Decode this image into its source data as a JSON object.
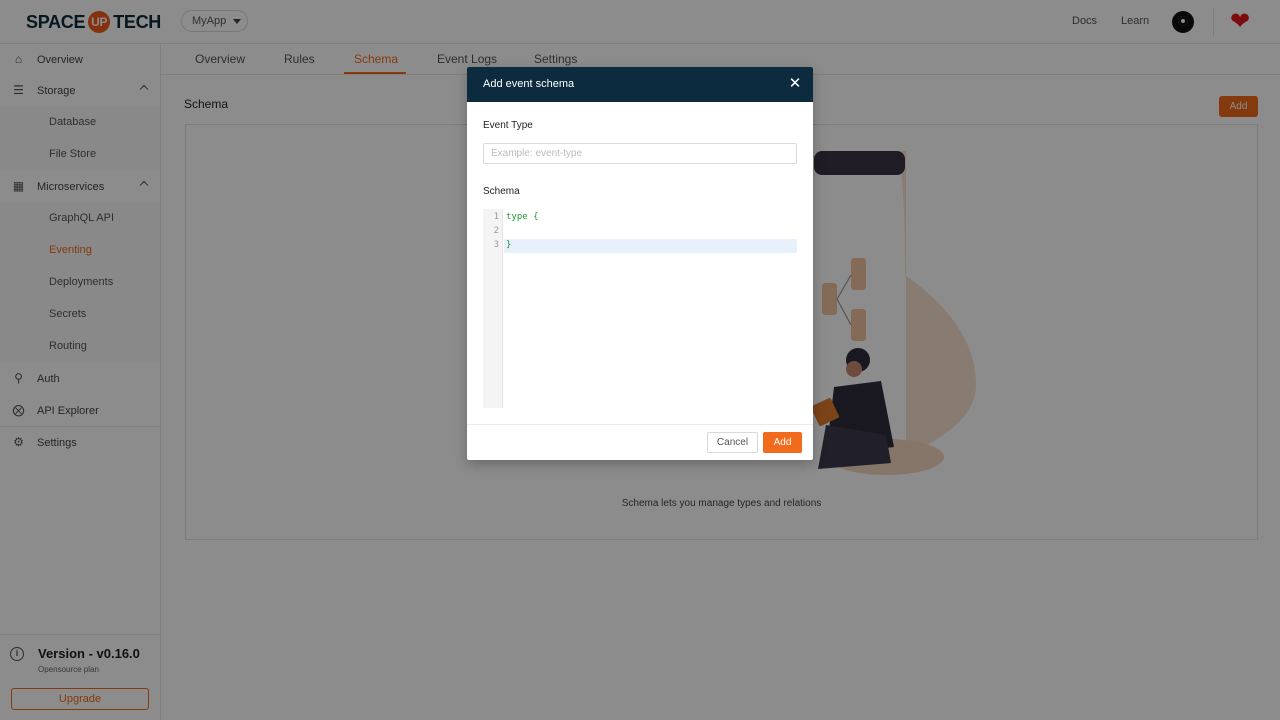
{
  "brand": {
    "logo_left": "SPACE",
    "logo_mid": "UP",
    "logo_right": "TECH"
  },
  "header": {
    "project": "MyApp",
    "docs": "Docs",
    "learn": "Learn"
  },
  "sidebar": {
    "items": [
      {
        "label": "Overview",
        "icon": "home-icon"
      },
      {
        "label": "Storage",
        "icon": "storage-icon",
        "expanded": true
      },
      {
        "label": "Microservices",
        "icon": "microservices-icon",
        "expanded": true
      },
      {
        "label": "Auth",
        "icon": "auth-icon"
      },
      {
        "label": "API Explorer",
        "icon": "compass-icon"
      },
      {
        "label": "Settings",
        "icon": "gear-icon"
      }
    ],
    "storage_sub": [
      "Database",
      "File Store"
    ],
    "micro_sub": [
      "GraphQL API",
      "Eventing",
      "Deployments",
      "Secrets",
      "Routing"
    ],
    "active_sub": "Eventing",
    "version": "Version - v0.16.0",
    "plan": "Opensource plan",
    "upgrade": "Upgrade"
  },
  "tabs": [
    "Overview",
    "Rules",
    "Schema",
    "Event Logs",
    "Settings"
  ],
  "active_tab": "Schema",
  "main": {
    "title": "Schema",
    "add_label": "Add",
    "empty_text": "Schema lets you manage types and relations"
  },
  "modal": {
    "title": "Add event schema",
    "close_icon": "close-icon",
    "event_type_label": "Event Type",
    "event_type_placeholder": "Example: event-type",
    "event_type_value": "",
    "schema_label": "Schema",
    "line_numbers": [
      "1",
      "2",
      "3"
    ],
    "code_lines": [
      "type {",
      "",
      "}"
    ],
    "cancel_label": "Cancel",
    "add_label": "Add"
  },
  "colors": {
    "accent": "#f26a1b",
    "header_dark": "#0d2b3e",
    "code_green": "#1f9a2f",
    "heart": "#e0181e"
  }
}
